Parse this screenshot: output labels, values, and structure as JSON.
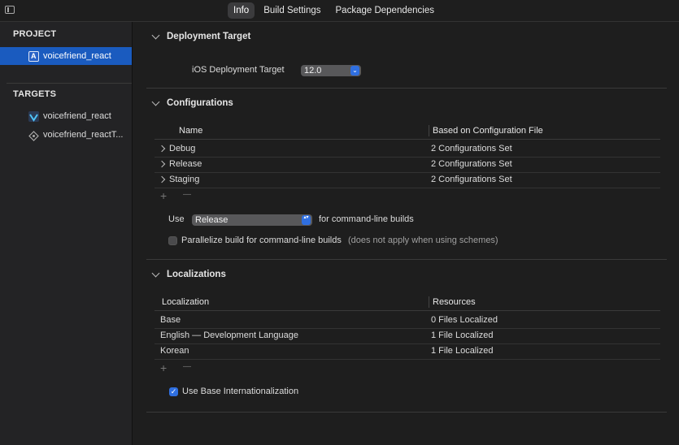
{
  "tabs": [
    {
      "label": "Info",
      "active": true
    },
    {
      "label": "Build Settings",
      "active": false
    },
    {
      "label": "Package Dependencies",
      "active": false
    }
  ],
  "sidebar": {
    "project_header": "PROJECT",
    "project_item": "voicefriend_react",
    "targets_header": "TARGETS",
    "targets": [
      "voicefriend_react",
      "voicefriend_reactT..."
    ]
  },
  "deployment": {
    "header": "Deployment Target",
    "label": "iOS Deployment Target",
    "value": "12.0"
  },
  "configurations": {
    "header": "Configurations",
    "col_name": "Name",
    "col_based": "Based on Configuration File",
    "rows": [
      {
        "name": "Debug",
        "based": "2 Configurations Set"
      },
      {
        "name": "Release",
        "based": "2 Configurations Set"
      },
      {
        "name": "Staging",
        "based": "2 Configurations Set"
      }
    ],
    "use_label": "Use",
    "use_value": "Release",
    "use_suffix": "for command-line builds",
    "parallelize_label": "Parallelize build for command-line builds",
    "parallelize_note": "(does not apply when using schemes)"
  },
  "localizations": {
    "header": "Localizations",
    "col_loc": "Localization",
    "col_res": "Resources",
    "rows": [
      {
        "name": "Base",
        "res": "0 Files Localized"
      },
      {
        "name": "English — Development Language",
        "res": "1 File Localized"
      },
      {
        "name": "Korean",
        "res": "1 File Localized"
      }
    ],
    "base_i18n_label": "Use Base Internationalization"
  },
  "icons": {
    "plus": "+",
    "minus": "—",
    "check": "✓",
    "popup_arrows": "▴▾"
  },
  "colors": {
    "accent": "#1a5bbf",
    "checkbox": "#2f6fe0"
  }
}
